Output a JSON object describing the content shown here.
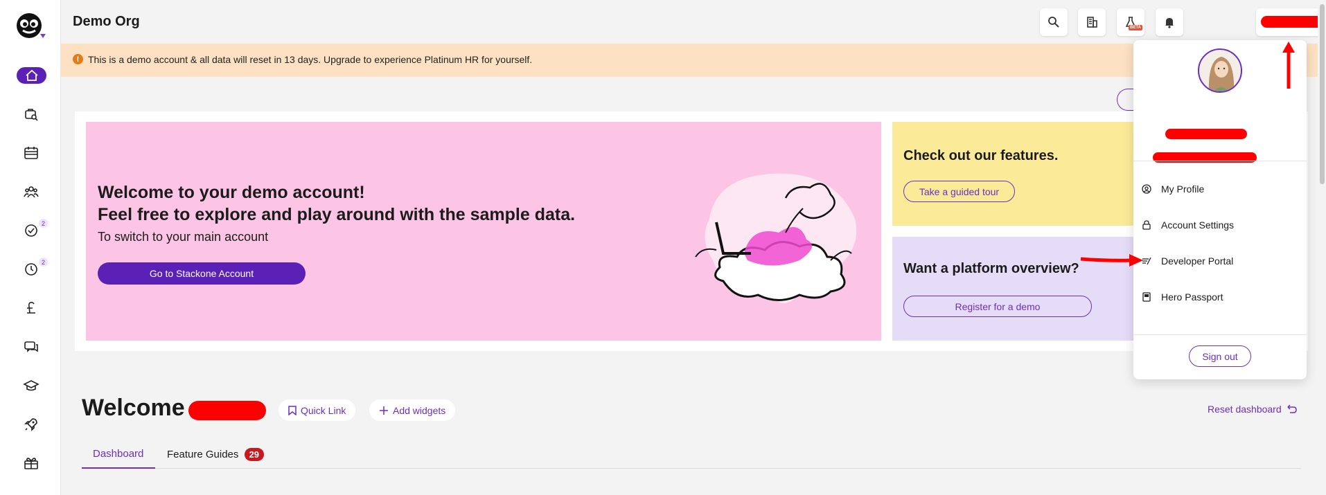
{
  "topbar": {
    "org_name": "Demo Org",
    "beta_label": "BETA",
    "icons": [
      "search-icon",
      "building-icon",
      "flask-icon",
      "bell-icon"
    ]
  },
  "sidebar": {
    "items": [
      {
        "icon": "home-icon"
      },
      {
        "icon": "briefcase-search-icon"
      },
      {
        "icon": "calendar-icon"
      },
      {
        "icon": "team-icon"
      },
      {
        "icon": "check-circle-icon",
        "badge": "2"
      },
      {
        "icon": "clock-icon",
        "badge": "2"
      },
      {
        "icon": "pound-icon"
      },
      {
        "icon": "chat-icon"
      },
      {
        "icon": "graduation-cap-icon"
      },
      {
        "icon": "rocket-icon"
      },
      {
        "icon": "gift-icon"
      }
    ]
  },
  "banner": {
    "text": "This is a demo account & all data will reset in 13 days. Upgrade to experience Platinum HR for yourself."
  },
  "hero": {
    "title_line1": "Welcome to your demo account!",
    "title_line2": "Feel free to explore and play around with the sample data.",
    "subtitle": "To switch to your main account",
    "button": "Go to Stackone Account"
  },
  "features": {
    "title": "Check out our features.",
    "button": "Take a guided tour"
  },
  "platform": {
    "title": "Want a platform overview?",
    "button": "Register for a demo"
  },
  "welcome": {
    "title": "Welcome",
    "quick_link": "Quick Link",
    "add_widgets": "Add widgets",
    "reset": "Reset dashboard"
  },
  "tabs": [
    {
      "label": "Dashboard",
      "active": true
    },
    {
      "label": "Feature Guides",
      "count": "29"
    }
  ],
  "dropdown": {
    "items": [
      {
        "label": "My Profile",
        "icon": "user-circle-icon"
      },
      {
        "label": "Account Settings",
        "icon": "lock-icon"
      },
      {
        "label": "Developer Portal",
        "icon": "code-icon"
      },
      {
        "label": "Hero Passport",
        "icon": "passport-icon"
      }
    ],
    "sign_out": "Sign out"
  },
  "colors": {
    "brand_purple": "#5b21b6",
    "banner_bg": "#fde1c3",
    "hero_pink": "#fcc5e6",
    "feature_yellow": "#fbeb98",
    "platform_lilac": "#e5dcf7",
    "redaction_red": "#ff0000"
  }
}
